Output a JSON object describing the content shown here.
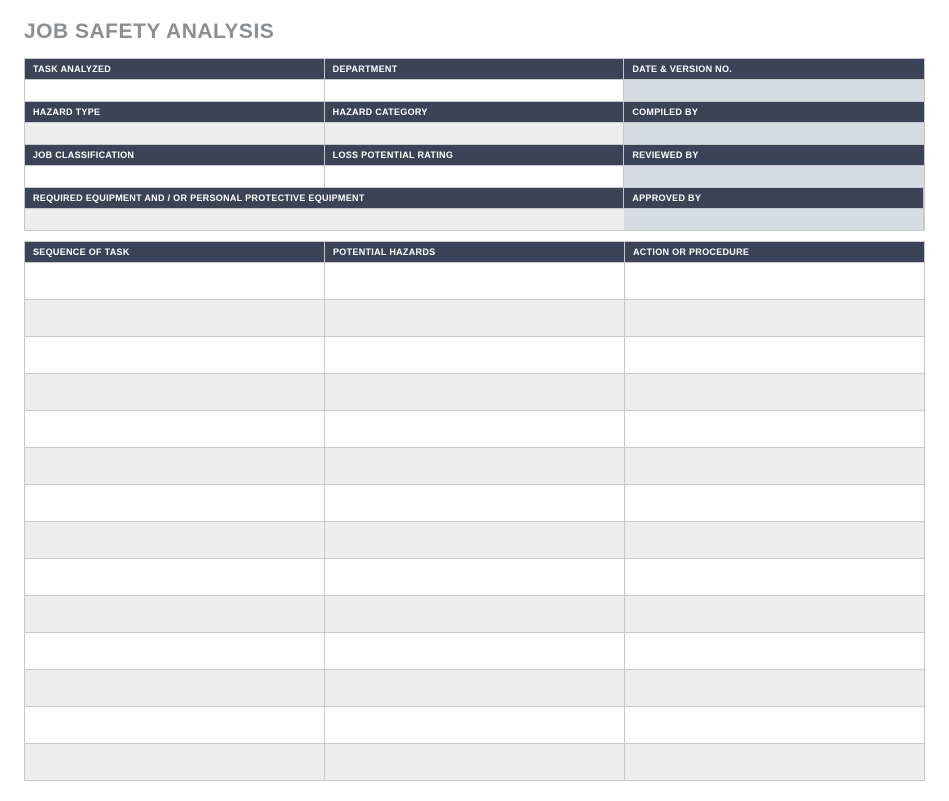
{
  "title": "JOB SAFETY ANALYSIS",
  "info": {
    "task_analyzed": {
      "label": "TASK ANALYZED",
      "value": ""
    },
    "department": {
      "label": "DEPARTMENT",
      "value": ""
    },
    "date_version": {
      "label": "DATE & VERSION NO.",
      "value": ""
    },
    "hazard_type": {
      "label": "HAZARD TYPE",
      "value": ""
    },
    "hazard_category": {
      "label": "HAZARD CATEGORY",
      "value": ""
    },
    "compiled_by": {
      "label": "COMPILED BY",
      "value": ""
    },
    "job_classification": {
      "label": "JOB CLASSIFICATION",
      "value": ""
    },
    "loss_potential_rating": {
      "label": "LOSS POTENTIAL RATING",
      "value": ""
    },
    "reviewed_by": {
      "label": "REVIEWED BY",
      "value": ""
    },
    "required_equipment": {
      "label": "REQUIRED EQUIPMENT AND / OR PERSONAL PROTECTIVE EQUIPMENT",
      "value": ""
    },
    "approved_by": {
      "label": "APPROVED BY",
      "value": ""
    }
  },
  "task_table": {
    "headers": {
      "sequence": "SEQUENCE OF TASK",
      "hazards": "POTENTIAL HAZARDS",
      "action": "ACTION OR PROCEDURE"
    },
    "rows": [
      {
        "sequence": "",
        "hazards": "",
        "action": ""
      },
      {
        "sequence": "",
        "hazards": "",
        "action": ""
      },
      {
        "sequence": "",
        "hazards": "",
        "action": ""
      },
      {
        "sequence": "",
        "hazards": "",
        "action": ""
      },
      {
        "sequence": "",
        "hazards": "",
        "action": ""
      },
      {
        "sequence": "",
        "hazards": "",
        "action": ""
      },
      {
        "sequence": "",
        "hazards": "",
        "action": ""
      },
      {
        "sequence": "",
        "hazards": "",
        "action": ""
      },
      {
        "sequence": "",
        "hazards": "",
        "action": ""
      },
      {
        "sequence": "",
        "hazards": "",
        "action": ""
      },
      {
        "sequence": "",
        "hazards": "",
        "action": ""
      },
      {
        "sequence": "",
        "hazards": "",
        "action": ""
      },
      {
        "sequence": "",
        "hazards": "",
        "action": ""
      },
      {
        "sequence": "",
        "hazards": "",
        "action": ""
      }
    ]
  }
}
